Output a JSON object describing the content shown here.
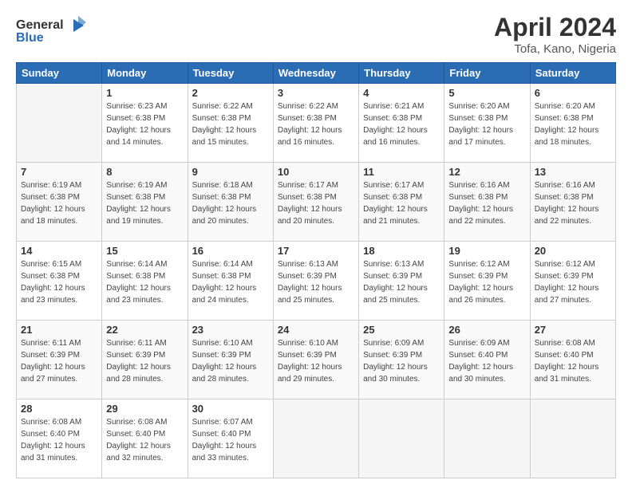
{
  "logo": {
    "text_general": "General",
    "text_blue": "Blue",
    "icon": "▶"
  },
  "title": {
    "main": "April 2024",
    "sub": "Tofa, Kano, Nigeria"
  },
  "calendar": {
    "headers": [
      "Sunday",
      "Monday",
      "Tuesday",
      "Wednesday",
      "Thursday",
      "Friday",
      "Saturday"
    ],
    "weeks": [
      [
        {
          "day": "",
          "sunrise": "",
          "sunset": "",
          "daylight": "",
          "empty": true
        },
        {
          "day": "1",
          "sunrise": "Sunrise: 6:23 AM",
          "sunset": "Sunset: 6:38 PM",
          "daylight": "Daylight: 12 hours and 14 minutes.",
          "empty": false
        },
        {
          "day": "2",
          "sunrise": "Sunrise: 6:22 AM",
          "sunset": "Sunset: 6:38 PM",
          "daylight": "Daylight: 12 hours and 15 minutes.",
          "empty": false
        },
        {
          "day": "3",
          "sunrise": "Sunrise: 6:22 AM",
          "sunset": "Sunset: 6:38 PM",
          "daylight": "Daylight: 12 hours and 16 minutes.",
          "empty": false
        },
        {
          "day": "4",
          "sunrise": "Sunrise: 6:21 AM",
          "sunset": "Sunset: 6:38 PM",
          "daylight": "Daylight: 12 hours and 16 minutes.",
          "empty": false
        },
        {
          "day": "5",
          "sunrise": "Sunrise: 6:20 AM",
          "sunset": "Sunset: 6:38 PM",
          "daylight": "Daylight: 12 hours and 17 minutes.",
          "empty": false
        },
        {
          "day": "6",
          "sunrise": "Sunrise: 6:20 AM",
          "sunset": "Sunset: 6:38 PM",
          "daylight": "Daylight: 12 hours and 18 minutes.",
          "empty": false
        }
      ],
      [
        {
          "day": "7",
          "sunrise": "Sunrise: 6:19 AM",
          "sunset": "Sunset: 6:38 PM",
          "daylight": "Daylight: 12 hours and 18 minutes.",
          "empty": false
        },
        {
          "day": "8",
          "sunrise": "Sunrise: 6:19 AM",
          "sunset": "Sunset: 6:38 PM",
          "daylight": "Daylight: 12 hours and 19 minutes.",
          "empty": false
        },
        {
          "day": "9",
          "sunrise": "Sunrise: 6:18 AM",
          "sunset": "Sunset: 6:38 PM",
          "daylight": "Daylight: 12 hours and 20 minutes.",
          "empty": false
        },
        {
          "day": "10",
          "sunrise": "Sunrise: 6:17 AM",
          "sunset": "Sunset: 6:38 PM",
          "daylight": "Daylight: 12 hours and 20 minutes.",
          "empty": false
        },
        {
          "day": "11",
          "sunrise": "Sunrise: 6:17 AM",
          "sunset": "Sunset: 6:38 PM",
          "daylight": "Daylight: 12 hours and 21 minutes.",
          "empty": false
        },
        {
          "day": "12",
          "sunrise": "Sunrise: 6:16 AM",
          "sunset": "Sunset: 6:38 PM",
          "daylight": "Daylight: 12 hours and 22 minutes.",
          "empty": false
        },
        {
          "day": "13",
          "sunrise": "Sunrise: 6:16 AM",
          "sunset": "Sunset: 6:38 PM",
          "daylight": "Daylight: 12 hours and 22 minutes.",
          "empty": false
        }
      ],
      [
        {
          "day": "14",
          "sunrise": "Sunrise: 6:15 AM",
          "sunset": "Sunset: 6:38 PM",
          "daylight": "Daylight: 12 hours and 23 minutes.",
          "empty": false
        },
        {
          "day": "15",
          "sunrise": "Sunrise: 6:14 AM",
          "sunset": "Sunset: 6:38 PM",
          "daylight": "Daylight: 12 hours and 23 minutes.",
          "empty": false
        },
        {
          "day": "16",
          "sunrise": "Sunrise: 6:14 AM",
          "sunset": "Sunset: 6:38 PM",
          "daylight": "Daylight: 12 hours and 24 minutes.",
          "empty": false
        },
        {
          "day": "17",
          "sunrise": "Sunrise: 6:13 AM",
          "sunset": "Sunset: 6:39 PM",
          "daylight": "Daylight: 12 hours and 25 minutes.",
          "empty": false
        },
        {
          "day": "18",
          "sunrise": "Sunrise: 6:13 AM",
          "sunset": "Sunset: 6:39 PM",
          "daylight": "Daylight: 12 hours and 25 minutes.",
          "empty": false
        },
        {
          "day": "19",
          "sunrise": "Sunrise: 6:12 AM",
          "sunset": "Sunset: 6:39 PM",
          "daylight": "Daylight: 12 hours and 26 minutes.",
          "empty": false
        },
        {
          "day": "20",
          "sunrise": "Sunrise: 6:12 AM",
          "sunset": "Sunset: 6:39 PM",
          "daylight": "Daylight: 12 hours and 27 minutes.",
          "empty": false
        }
      ],
      [
        {
          "day": "21",
          "sunrise": "Sunrise: 6:11 AM",
          "sunset": "Sunset: 6:39 PM",
          "daylight": "Daylight: 12 hours and 27 minutes.",
          "empty": false
        },
        {
          "day": "22",
          "sunrise": "Sunrise: 6:11 AM",
          "sunset": "Sunset: 6:39 PM",
          "daylight": "Daylight: 12 hours and 28 minutes.",
          "empty": false
        },
        {
          "day": "23",
          "sunrise": "Sunrise: 6:10 AM",
          "sunset": "Sunset: 6:39 PM",
          "daylight": "Daylight: 12 hours and 28 minutes.",
          "empty": false
        },
        {
          "day": "24",
          "sunrise": "Sunrise: 6:10 AM",
          "sunset": "Sunset: 6:39 PM",
          "daylight": "Daylight: 12 hours and 29 minutes.",
          "empty": false
        },
        {
          "day": "25",
          "sunrise": "Sunrise: 6:09 AM",
          "sunset": "Sunset: 6:39 PM",
          "daylight": "Daylight: 12 hours and 30 minutes.",
          "empty": false
        },
        {
          "day": "26",
          "sunrise": "Sunrise: 6:09 AM",
          "sunset": "Sunset: 6:40 PM",
          "daylight": "Daylight: 12 hours and 30 minutes.",
          "empty": false
        },
        {
          "day": "27",
          "sunrise": "Sunrise: 6:08 AM",
          "sunset": "Sunset: 6:40 PM",
          "daylight": "Daylight: 12 hours and 31 minutes.",
          "empty": false
        }
      ],
      [
        {
          "day": "28",
          "sunrise": "Sunrise: 6:08 AM",
          "sunset": "Sunset: 6:40 PM",
          "daylight": "Daylight: 12 hours and 31 minutes.",
          "empty": false
        },
        {
          "day": "29",
          "sunrise": "Sunrise: 6:08 AM",
          "sunset": "Sunset: 6:40 PM",
          "daylight": "Daylight: 12 hours and 32 minutes.",
          "empty": false
        },
        {
          "day": "30",
          "sunrise": "Sunrise: 6:07 AM",
          "sunset": "Sunset: 6:40 PM",
          "daylight": "Daylight: 12 hours and 33 minutes.",
          "empty": false
        },
        {
          "day": "",
          "sunrise": "",
          "sunset": "",
          "daylight": "",
          "empty": true
        },
        {
          "day": "",
          "sunrise": "",
          "sunset": "",
          "daylight": "",
          "empty": true
        },
        {
          "day": "",
          "sunrise": "",
          "sunset": "",
          "daylight": "",
          "empty": true
        },
        {
          "day": "",
          "sunrise": "",
          "sunset": "",
          "daylight": "",
          "empty": true
        }
      ]
    ]
  }
}
